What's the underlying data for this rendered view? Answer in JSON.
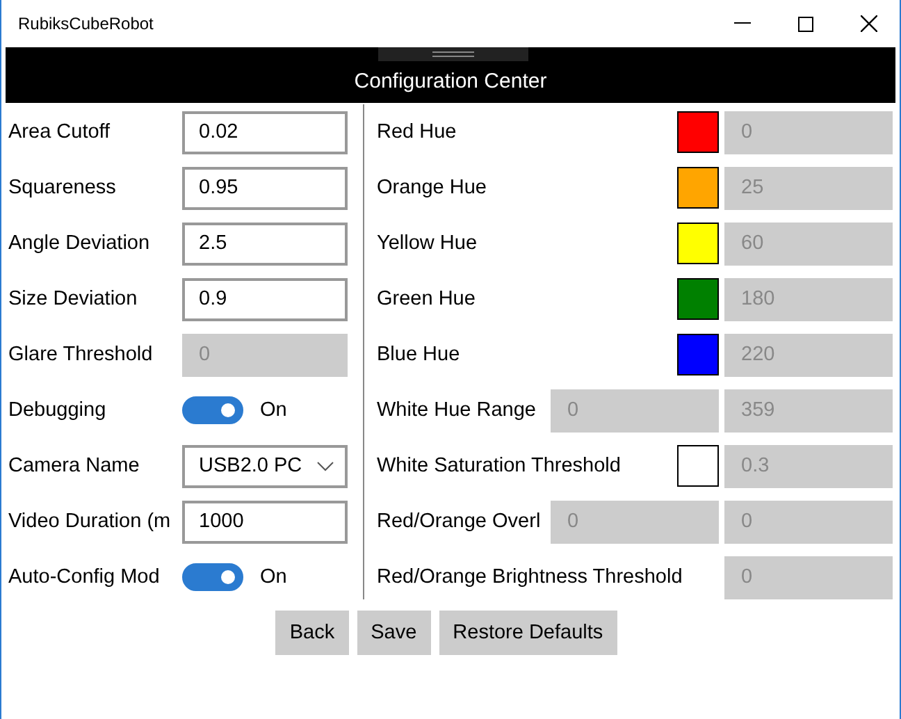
{
  "window": {
    "title": "RubiksCubeRobot"
  },
  "header": {
    "title": "Configuration Center"
  },
  "left_settings": [
    {
      "label": "Area Cutoff",
      "kind": "text",
      "value": "0.02",
      "disabled": false
    },
    {
      "label": "Squareness",
      "kind": "text",
      "value": "0.95",
      "disabled": false
    },
    {
      "label": "Angle Deviation",
      "kind": "text",
      "value": "2.5",
      "disabled": false
    },
    {
      "label": "Size Deviation",
      "kind": "text",
      "value": "0.9",
      "disabled": false
    },
    {
      "label": "Glare Threshold",
      "kind": "text",
      "value": "0",
      "disabled": true
    },
    {
      "label": "Debugging",
      "kind": "toggle",
      "on": true,
      "state_text": "On"
    },
    {
      "label": "Camera Name",
      "kind": "dropdown",
      "value": "USB2.0 PC"
    },
    {
      "label": "Video Duration (m",
      "kind": "text",
      "value": "1000",
      "disabled": false
    },
    {
      "label": "Auto-Config Mod",
      "kind": "toggle",
      "on": true,
      "state_text": "On"
    }
  ],
  "right_settings": [
    {
      "label": "Red Hue",
      "kind": "swatch",
      "color": "#ff0000",
      "fields": [
        "0"
      ]
    },
    {
      "label": "Orange Hue",
      "kind": "swatch",
      "color": "#ffa500",
      "fields": [
        "25"
      ]
    },
    {
      "label": "Yellow Hue",
      "kind": "swatch",
      "color": "#ffff00",
      "fields": [
        "60"
      ]
    },
    {
      "label": "Green Hue",
      "kind": "swatch",
      "color": "#008000",
      "fields": [
        "180"
      ]
    },
    {
      "label": "Blue Hue",
      "kind": "swatch",
      "color": "#0000ff",
      "fields": [
        "220"
      ]
    },
    {
      "label": "White Hue Range",
      "kind": "range",
      "fields": [
        "0",
        "359"
      ]
    },
    {
      "label": "White Saturation Threshold",
      "kind": "swatch",
      "color": "#ffffff",
      "fields": [
        "0.3"
      ]
    },
    {
      "label": "Red/Orange Overl",
      "kind": "range",
      "fields": [
        "0",
        "0"
      ]
    },
    {
      "label": "Red/Orange Brightness Threshold",
      "kind": "plain",
      "fields": [
        "0"
      ]
    }
  ],
  "buttons": [
    "Back",
    "Save",
    "Restore Defaults"
  ]
}
